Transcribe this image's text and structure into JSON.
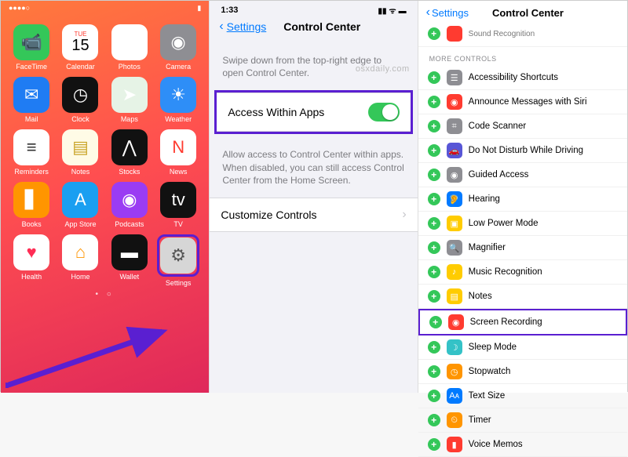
{
  "panel1": {
    "status": {
      "carrier_dots": "●●●●○",
      "day": "TUE",
      "date": "15",
      "battery": "▮"
    },
    "apps": [
      {
        "label": "FaceTime",
        "icon": "📹",
        "cls": "c-facetime"
      },
      {
        "label": "Calendar",
        "icon": "",
        "cls": "c-cal"
      },
      {
        "label": "Photos",
        "icon": "✿",
        "cls": "c-photos"
      },
      {
        "label": "Camera",
        "icon": "◉",
        "cls": "c-camera"
      },
      {
        "label": "Mail",
        "icon": "✉",
        "cls": "c-mail"
      },
      {
        "label": "Clock",
        "icon": "◷",
        "cls": "c-clock"
      },
      {
        "label": "Maps",
        "icon": "➤",
        "cls": "c-maps"
      },
      {
        "label": "Weather",
        "icon": "☀",
        "cls": "c-weather"
      },
      {
        "label": "Reminders",
        "icon": "≡",
        "cls": "c-rem"
      },
      {
        "label": "Notes",
        "icon": "▤",
        "cls": "c-notes"
      },
      {
        "label": "Stocks",
        "icon": "⋀",
        "cls": "c-stocks"
      },
      {
        "label": "News",
        "icon": "N",
        "cls": "c-news"
      },
      {
        "label": "Books",
        "icon": "▋",
        "cls": "c-books"
      },
      {
        "label": "App Store",
        "icon": "A",
        "cls": "c-appstore"
      },
      {
        "label": "Podcasts",
        "icon": "◉",
        "cls": "c-podcasts"
      },
      {
        "label": "TV",
        "icon": "tv",
        "cls": "c-tv"
      },
      {
        "label": "Health",
        "icon": "♥",
        "cls": "c-health"
      },
      {
        "label": "Home",
        "icon": "⌂",
        "cls": "c-home"
      },
      {
        "label": "Wallet",
        "icon": "▬",
        "cls": "c-wallet"
      },
      {
        "label": "Settings",
        "icon": "⚙",
        "cls": "c-settings",
        "highlight": true
      }
    ],
    "page_dots": "• ○"
  },
  "panel2": {
    "time": "1:33",
    "back": "Settings",
    "title": "Control Center",
    "desc1": "Swipe down from the top-right edge to open Control Center.",
    "watermark": "osxdaily.com",
    "access_label": "Access Within Apps",
    "access_on": true,
    "desc2": "Allow access to Control Center within apps. When disabled, you can still access Control Center from the Home Screen.",
    "customize": "Customize Controls"
  },
  "panel3": {
    "back": "Settings",
    "title": "Control Center",
    "prev_item": "Sound Recognition",
    "section": "MORE CONTROLS",
    "items": [
      {
        "label": "Accessibility Shortcuts",
        "bg": "#8e8e93",
        "g": "☰"
      },
      {
        "label": "Announce Messages with Siri",
        "bg": "#ff3b30",
        "g": "◉"
      },
      {
        "label": "Code Scanner",
        "bg": "#8e8e93",
        "g": "⌗"
      },
      {
        "label": "Do Not Disturb While Driving",
        "bg": "#5856d6",
        "g": "🚗"
      },
      {
        "label": "Guided Access",
        "bg": "#8e8e93",
        "g": "◉"
      },
      {
        "label": "Hearing",
        "bg": "#027aff",
        "g": "🦻"
      },
      {
        "label": "Low Power Mode",
        "bg": "#ffcc00",
        "g": "▣"
      },
      {
        "label": "Magnifier",
        "bg": "#8e8e93",
        "g": "🔍"
      },
      {
        "label": "Music Recognition",
        "bg": "#ffcc00",
        "g": "♪"
      },
      {
        "label": "Notes",
        "bg": "#ffcc00",
        "g": "▤"
      },
      {
        "label": "Screen Recording",
        "bg": "#ff3b30",
        "g": "◉",
        "highlight": true
      },
      {
        "label": "Sleep Mode",
        "bg": "#34c2c7",
        "g": "☽"
      },
      {
        "label": "Stopwatch",
        "bg": "#ff9500",
        "g": "◷"
      },
      {
        "label": "Text Size",
        "bg": "#007aff",
        "g": "Aᴀ"
      },
      {
        "label": "Timer",
        "bg": "#ff9500",
        "g": "⏲"
      },
      {
        "label": "Voice Memos",
        "bg": "#ff3b30",
        "g": "▮"
      }
    ]
  }
}
